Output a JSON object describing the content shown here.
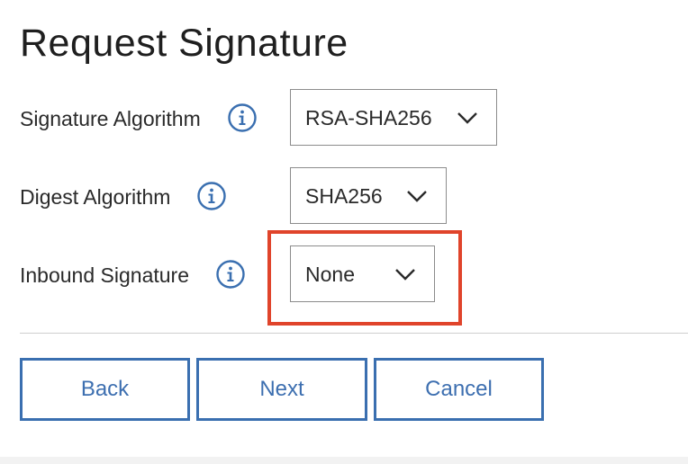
{
  "page": {
    "title": "Request Signature"
  },
  "fields": {
    "signature_algorithm": {
      "label": "Signature Algorithm",
      "value": "RSA-SHA256"
    },
    "digest_algorithm": {
      "label": "Digest Algorithm",
      "value": "SHA256"
    },
    "inbound_signature": {
      "label": "Inbound Signature",
      "value": "None"
    }
  },
  "buttons": {
    "back": "Back",
    "next": "Next",
    "cancel": "Cancel"
  },
  "icons": {
    "info": "info-circle-icon",
    "dropdown": "chevron-down-icon"
  },
  "colors": {
    "accent_blue": "#3a6fb0",
    "highlight_red": "#e0442b",
    "text": "#1f1f1f",
    "border_gray": "#8c8c8c"
  }
}
